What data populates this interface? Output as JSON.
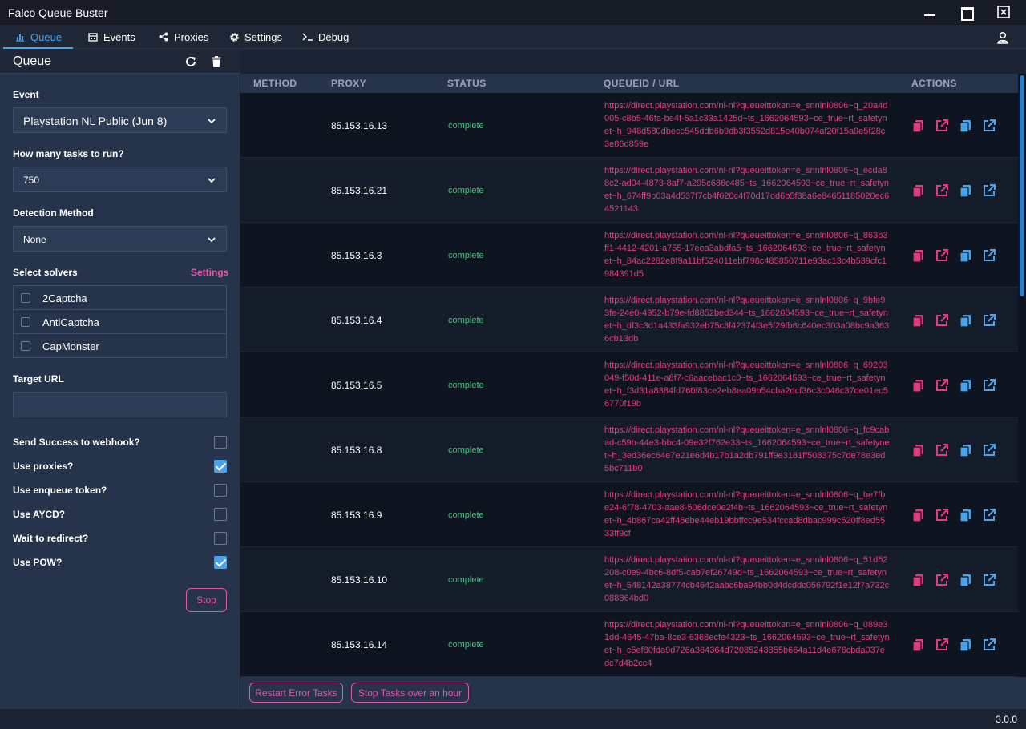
{
  "window": {
    "title": "Falco Queue Buster"
  },
  "nav": {
    "tabs": [
      {
        "label": "Queue",
        "icon": "chart-icon"
      },
      {
        "label": "Events",
        "icon": "calendar-icon"
      },
      {
        "label": "Proxies",
        "icon": "share-icon"
      },
      {
        "label": "Settings",
        "icon": "gear-icon"
      },
      {
        "label": "Debug",
        "icon": "terminal-icon"
      }
    ],
    "active_tab": "Queue"
  },
  "sidebar": {
    "title": "Queue",
    "event": {
      "label": "Event",
      "value": "Playstation NL Public (Jun 8)"
    },
    "tasks": {
      "label": "How many tasks to run?",
      "value": "750"
    },
    "detection": {
      "label": "Detection Method",
      "value": "None"
    },
    "solvers": {
      "label": "Select solvers",
      "settings_link": "Settings",
      "items": [
        {
          "label": "2Captcha",
          "checked": false
        },
        {
          "label": "AntiCaptcha",
          "checked": false
        },
        {
          "label": "CapMonster",
          "checked": false
        }
      ]
    },
    "target_url": {
      "label": "Target URL",
      "value": ""
    },
    "options": [
      {
        "label": "Send Success to webhook?",
        "checked": false
      },
      {
        "label": "Use proxies?",
        "checked": true
      },
      {
        "label": "Use enqueue token?",
        "checked": false
      },
      {
        "label": "Use AYCD?",
        "checked": false
      },
      {
        "label": "Wait to redirect?",
        "checked": false
      },
      {
        "label": "Use POW?",
        "checked": true
      }
    ],
    "stop_label": "Stop"
  },
  "table": {
    "headers": {
      "method": "METHOD",
      "proxy": "PROXY",
      "status": "STATUS",
      "url": "QUEUEID / URL",
      "actions": "ACTIONS"
    },
    "rows": [
      {
        "proxy": "85.153.16.13",
        "status": "complete",
        "url": "https://direct.playstation.com/nl-nl?queueittoken=e_snnlnl0806~q_20a4d005-c8b5-46fa-be4f-5a1c33a1425d~ts_1662064593~ce_true~rt_safetynet~h_948d580dbecc545ddb6b9db3f3552d815e40b074af20f15a9e5f28c3e86d859e"
      },
      {
        "proxy": "85.153.16.21",
        "status": "complete",
        "url": "https://direct.playstation.com/nl-nl?queueittoken=e_snnlnl0806~q_ecda88c2-ad04-4873-8af7-a295c686c485~ts_1662064593~ce_true~rt_safetynet~h_674ff9b03a4d537f7cb4f620c4f70d17dd6b5f38a6e84651185020ec64521143"
      },
      {
        "proxy": "85.153.16.3",
        "status": "complete",
        "url": "https://direct.playstation.com/nl-nl?queueittoken=e_snnlnl0806~q_863b3ff1-4412-4201-a755-17eea3abdfa5~ts_1662064593~ce_true~rt_safetynet~h_84ac2282e8f9a11bf524011ebf798c485850711e93ac13c4b539cfc1984391d5"
      },
      {
        "proxy": "85.153.16.4",
        "status": "complete",
        "url": "https://direct.playstation.com/nl-nl?queueittoken=e_snnlnl0806~q_9bfe93fe-24e0-4952-b79e-fd8852bed344~ts_1662064593~ce_true~rt_safetynet~h_df3c3d1a433fa932eb75c3f42374f3e5f29fb6c640ec303a08bc9a3636cb13db"
      },
      {
        "proxy": "85.153.16.5",
        "status": "complete",
        "url": "https://direct.playstation.com/nl-nl?queueittoken=e_snnlnl0806~q_69203049-f50d-411e-a8f7-c6aacebac1c0~ts_1662064593~ce_true~rt_safetynet~h_f3d31a8384fd760f83ce2eb8ea09b54cba2dcf36c3c046c37de01ec56770f19b"
      },
      {
        "proxy": "85.153.16.8",
        "status": "complete",
        "url": "https://direct.playstation.com/nl-nl?queueittoken=e_snnlnl0806~q_fc9cabad-c59b-44e3-bbc4-09e32f762e33~ts_1662064593~ce_true~rt_safetynet~h_3ed36ec64e7e21e6d4b17b1a2db791ff9e3181ff508375c7de78e3ed5bc711b0"
      },
      {
        "proxy": "85.153.16.9",
        "status": "complete",
        "url": "https://direct.playstation.com/nl-nl?queueittoken=e_snnlnl0806~q_be7fbe24-6f78-4703-aae8-506dce0e2f4b~ts_1662064593~ce_true~rt_safetynet~h_4b867ca42ff46ebe44eb19bbffcc9e534fccad8dbac999c520ff8ed5533ff9cf"
      },
      {
        "proxy": "85.153.16.10",
        "status": "complete",
        "url": "https://direct.playstation.com/nl-nl?queueittoken=e_snnlnl0806~q_51d52208-c0e9-4bc6-8df5-cab7ef26749d~ts_1662064593~ce_true~rt_safetynet~h_548142a38774cb4642aabc6ba94bb0d4dcddc056792f1e12f7a732c088864bd0"
      },
      {
        "proxy": "85.153.16.14",
        "status": "complete",
        "url": "https://direct.playstation.com/nl-nl?queueittoken=e_snnlnl0806~q_089e31dd-4645-47ba-8ce3-6368ecfe4323~ts_1662064593~ce_true~rt_safetynet~h_c5ef80fda9d726a364364d72085243355b664a11d4e676cbda037edc7d4b2cc4"
      }
    ]
  },
  "bottom": {
    "restart_label": "Restart Error Tasks",
    "stop_old_label": "Stop Tasks over an hour"
  },
  "status": {
    "version": "3.0.0"
  },
  "colors": {
    "accent": "#4aa3e8",
    "pink": "#e456a9",
    "url": "#e03d7e",
    "complete": "#3ec37a"
  }
}
